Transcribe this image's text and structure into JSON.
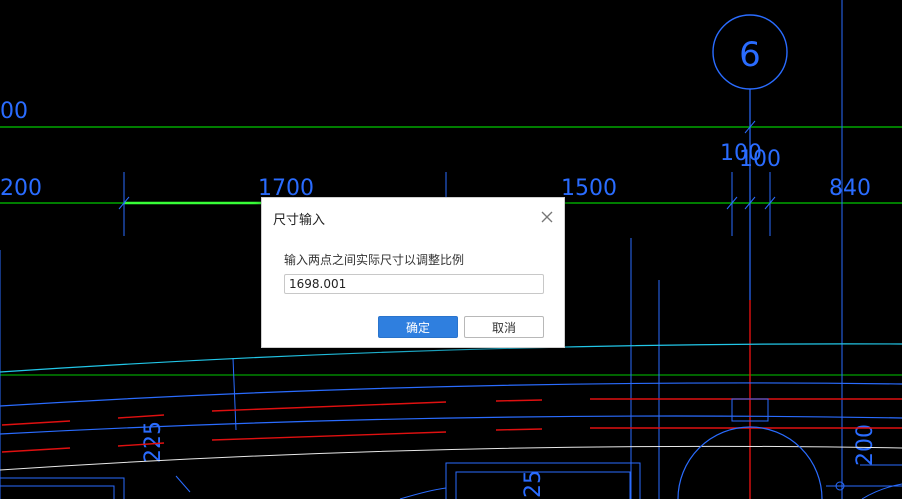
{
  "cad": {
    "grid_bubble_label": "6",
    "dimensions": {
      "d00": "00",
      "d200": "200",
      "d1700": "1700",
      "d1500": "1500",
      "d100a": "100",
      "d100b": "100",
      "d840": "840",
      "d225": "225",
      "d25": "25",
      "d200v": "200"
    },
    "colors": {
      "green": "#00c800",
      "blue": "#2a6cff",
      "cyan": "#22c7e8",
      "red": "#e01010",
      "white": "#e8e8e8"
    }
  },
  "dialog": {
    "title": "尺寸输入",
    "close_icon": "close-icon",
    "prompt": "输入两点之间实际尺寸以调整比例",
    "value": "1698.001",
    "ok_label": "确定",
    "cancel_label": "取消"
  }
}
